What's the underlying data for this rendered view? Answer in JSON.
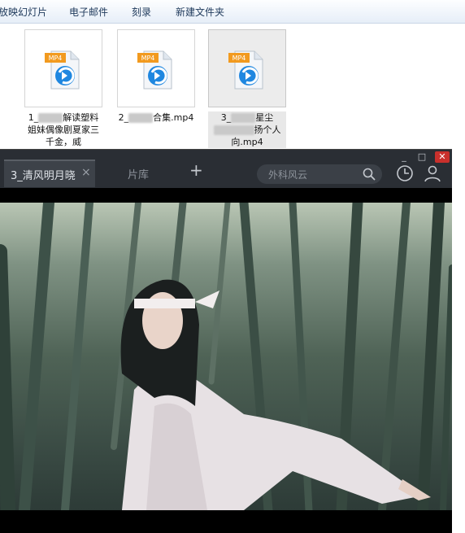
{
  "explorer": {
    "toolbar": [
      {
        "label": "放映幻灯片"
      },
      {
        "label": "电子邮件"
      },
      {
        "label": "刻录"
      },
      {
        "label": "新建文件夹"
      }
    ],
    "files": [
      {
        "badge": "MP4",
        "name_a": "1_",
        "name_b": "解读塑料姐妹偶像剧夏家三千金，威"
      },
      {
        "badge": "MP4",
        "name_a": "2_",
        "name_b": "合集.mp4"
      },
      {
        "badge": "MP4",
        "name_a": "3_",
        "name_b": "星尘",
        "name_c": "扬个人向.mp4"
      }
    ]
  },
  "player": {
    "active_tab": "3_清风明月晓",
    "tab_close": "×",
    "library_tab": "片库",
    "new_tab": "+",
    "search_placeholder": "外科风云",
    "window_buttons": {
      "minimize": "_",
      "maximize": "□",
      "close": "✕"
    },
    "colors": {
      "titlebar": "#2a2e34",
      "close": "#c9302c",
      "mp4_badge": "#f29a1f",
      "play_icon": "#1f87e0"
    }
  },
  "icons": [
    "mp4-file-icon",
    "search-icon",
    "history-icon",
    "user-icon"
  ]
}
